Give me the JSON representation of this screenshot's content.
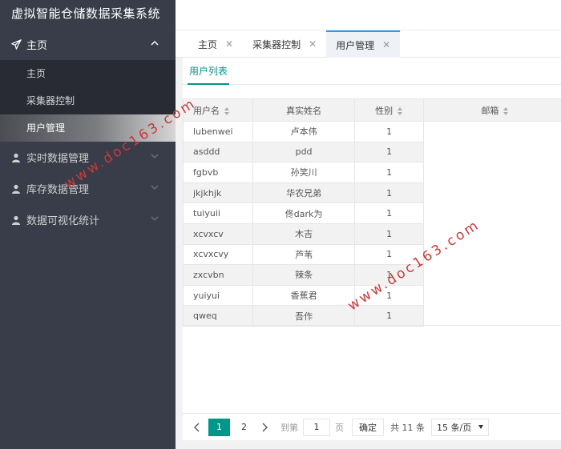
{
  "app": {
    "title": "虚拟智能仓储数据采集系统"
  },
  "sidebar": {
    "home": {
      "label": "主页",
      "icon": "paper-plane-icon"
    },
    "home_items": [
      {
        "label": "主页"
      },
      {
        "label": "采集器控制"
      },
      {
        "label": "用户管理",
        "active": true
      }
    ],
    "groups": [
      {
        "label": "实时数据管理",
        "icon": "user-icon"
      },
      {
        "label": "库存数据管理",
        "icon": "user-icon"
      },
      {
        "label": "数据可视化统计",
        "icon": "user-icon"
      }
    ]
  },
  "tabs": [
    {
      "label": "主页"
    },
    {
      "label": "采集器控制"
    },
    {
      "label": "用户管理",
      "active": true
    }
  ],
  "subtab": {
    "label": "用户列表"
  },
  "table": {
    "columns": [
      "用户名",
      "真实姓名",
      "性别",
      "邮箱"
    ],
    "rows": [
      [
        "lubenwei",
        "卢本伟",
        "1",
        ""
      ],
      [
        "asddd",
        "pdd",
        "1",
        ""
      ],
      [
        "fgbvb",
        "孙笑川",
        "1",
        ""
      ],
      [
        "jkjkhjk",
        "华农兄弟",
        "1",
        ""
      ],
      [
        "tuiyuii",
        "佟dark为",
        "1",
        ""
      ],
      [
        "xcvxcv",
        "木吉",
        "1",
        ""
      ],
      [
        "xcvxcvy",
        "芦苇",
        "1",
        ""
      ],
      [
        "zxcvbn",
        "辣条",
        "1",
        ""
      ],
      [
        "yuiyui",
        "香蕉君",
        "1",
        ""
      ],
      [
        "qweq",
        "吾作",
        "1",
        ""
      ]
    ]
  },
  "pagination": {
    "current": "1",
    "pages": [
      "1",
      "2"
    ],
    "goto_label": "到第",
    "goto_value": "1",
    "page_suffix": "页",
    "confirm": "确定",
    "total": "共 11 条",
    "page_size": "15 条/页"
  },
  "watermark": "www.doc163.com",
  "colors": {
    "sidebar_bg": "#393d49",
    "accent": "#009688",
    "tab_accent": "#1e9fff"
  }
}
